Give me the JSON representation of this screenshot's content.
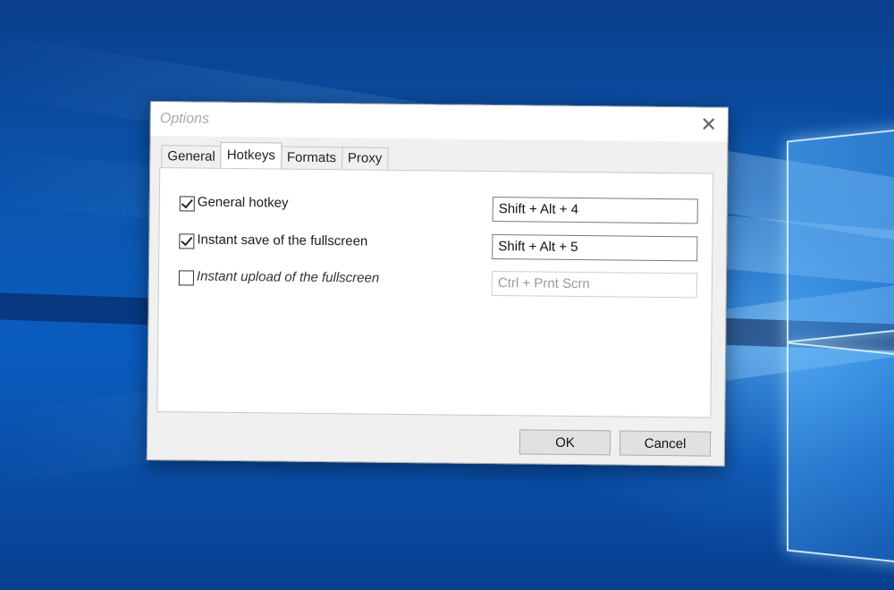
{
  "dialog": {
    "title": "Options",
    "close_symbol": "✕"
  },
  "tabs": [
    {
      "label": "General",
      "active": false
    },
    {
      "label": "Hotkeys",
      "active": true
    },
    {
      "label": "Formats",
      "active": false
    },
    {
      "label": "Proxy",
      "active": false
    }
  ],
  "hotkeys": [
    {
      "label": "General hotkey",
      "checked": true,
      "value": "Shift + Alt + 4",
      "enabled": true
    },
    {
      "label": "Instant save of the fullscreen",
      "checked": true,
      "value": "Shift + Alt + 5",
      "enabled": true
    },
    {
      "label": "Instant upload of the fullscreen",
      "checked": false,
      "value": "Ctrl + Prnt Scrn",
      "enabled": false
    }
  ],
  "buttons": {
    "ok": "OK",
    "cancel": "Cancel"
  },
  "colors": {
    "desktop_blue": "#0b56b0",
    "dialog_bg": "#f0f0f0"
  }
}
